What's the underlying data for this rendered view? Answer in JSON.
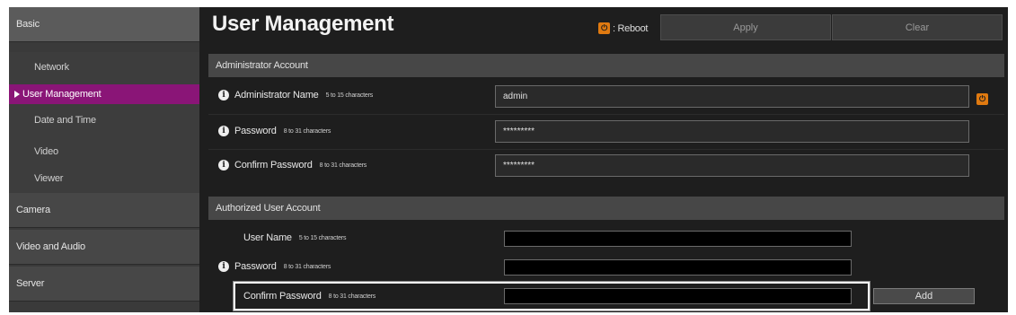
{
  "sidebar": {
    "categories": {
      "basic": "Basic",
      "camera": "Camera",
      "video_audio": "Video and Audio",
      "server": "Server"
    },
    "items": [
      {
        "label": "Network",
        "active": false
      },
      {
        "label": "User Management",
        "active": true
      },
      {
        "label": "Date and Time",
        "active": false
      },
      {
        "label": "Video",
        "active": false
      },
      {
        "label": "Viewer",
        "active": false
      }
    ]
  },
  "header": {
    "title": "User Management",
    "reboot_legend": ": Reboot",
    "apply_label": "Apply",
    "clear_label": "Clear"
  },
  "admin": {
    "section_title": "Administrator Account",
    "name_label": "Administrator Name",
    "name_hint": "5 to 15 characters",
    "name_value": "admin",
    "password_label": "Password",
    "password_hint": "8 to 31 characters",
    "password_value": "*********",
    "confirm_label": "Confirm Password",
    "confirm_hint": "8 to 31 characters",
    "confirm_value": "*********"
  },
  "authorized": {
    "section_title": "Authorized User Account",
    "user_label": "User Name",
    "user_hint": "5 to 15 characters",
    "password_label": "Password",
    "password_hint": "8 to 31 characters",
    "confirm_label": "Confirm Password",
    "confirm_hint": "8 to 31 characters",
    "add_label": "Add"
  },
  "icons": {
    "reboot": "power-icon",
    "info": "info-icon"
  },
  "colors": {
    "active_nav": "#8a1577",
    "reboot": "#e07a10"
  }
}
